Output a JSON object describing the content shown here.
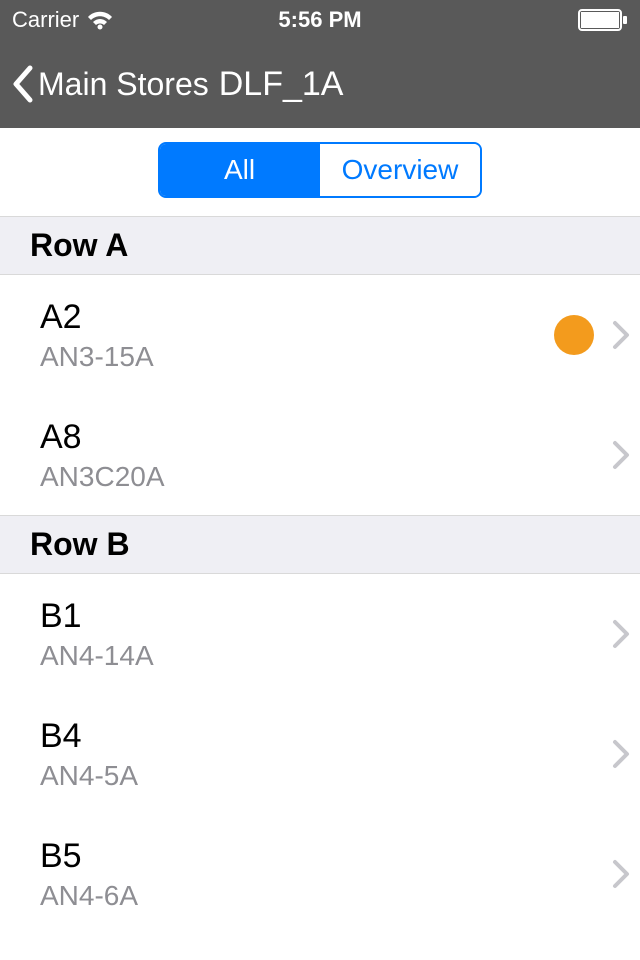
{
  "status_bar": {
    "carrier": "Carrier",
    "time": "5:56 PM"
  },
  "nav": {
    "back_label": "Main Stores",
    "title": "DLF_1A"
  },
  "segmented": {
    "all_label": "All",
    "overview_label": "Overview",
    "selected": "all"
  },
  "colors": {
    "status_dot": "#f39b1d"
  },
  "sections": [
    {
      "header": "Row A",
      "rows": [
        {
          "title": "A2",
          "subtitle": "AN3-15A",
          "has_dot": true
        },
        {
          "title": "A8",
          "subtitle": "AN3C20A",
          "has_dot": false
        }
      ]
    },
    {
      "header": "Row B",
      "rows": [
        {
          "title": "B1",
          "subtitle": "AN4-14A",
          "has_dot": false
        },
        {
          "title": "B4",
          "subtitle": "AN4-5A",
          "has_dot": false
        },
        {
          "title": "B5",
          "subtitle": "AN4-6A",
          "has_dot": false
        }
      ]
    }
  ]
}
